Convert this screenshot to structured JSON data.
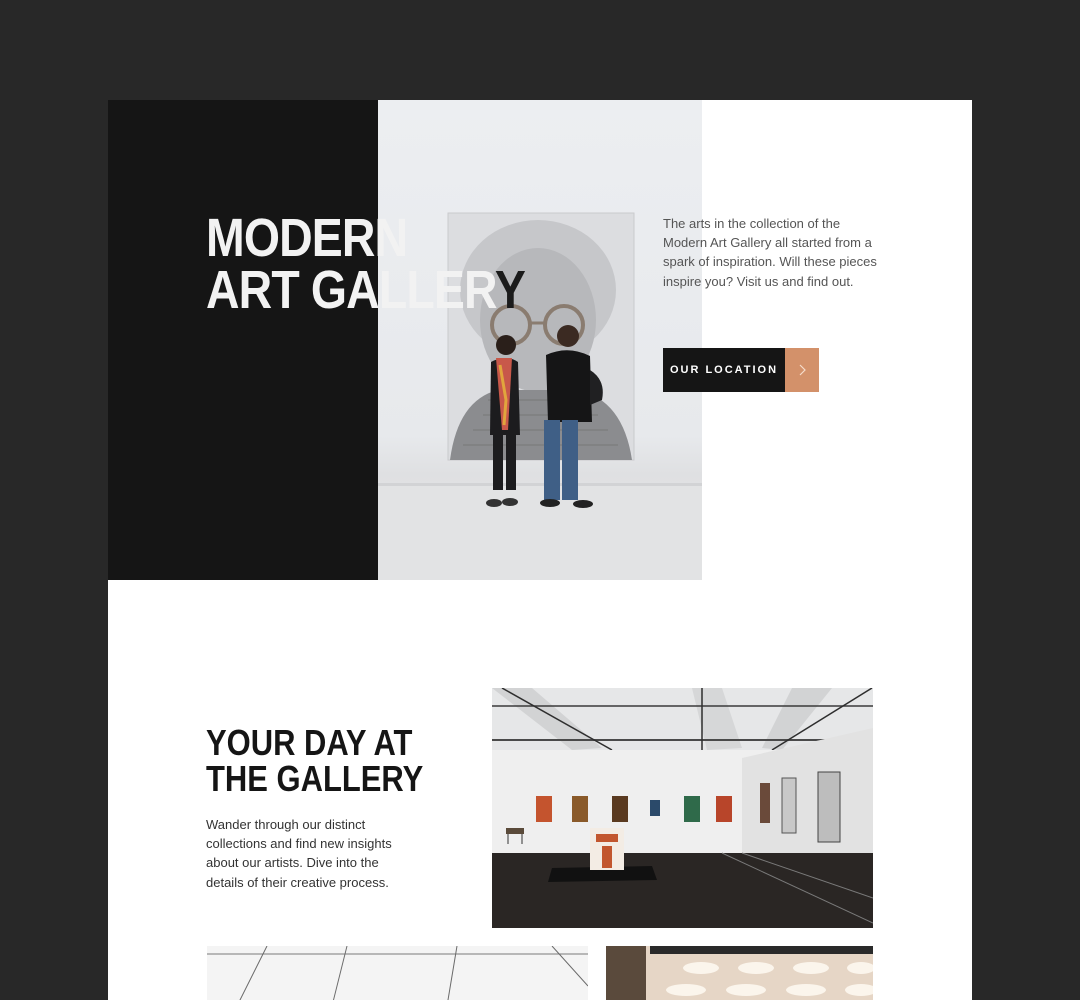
{
  "hero": {
    "title_line1": "MODERN",
    "title_line2": "ART GALLERY",
    "description": "The arts in the collection of the Modern Art Gallery all started from a spark of inspiration. Will these pieces inspire you? Visit us and find out.",
    "location_button": "OUR LOCATION",
    "button_icon": "chevron-right-icon",
    "photo": "visitors-viewing-portrait-photo"
  },
  "day": {
    "title_line1": "YOUR DAY AT",
    "title_line2": "THE GALLERY",
    "description": "Wander through our distinct collections and find new insights about our artists. Dive into the details of their creative process.",
    "photos": [
      "gallery-hall-photo",
      "gallery-ceiling-photo",
      "gallery-lights-photo"
    ]
  },
  "colors": {
    "page_background": "#282828",
    "dark": "#151515",
    "accent": "#d3916a",
    "white": "#ffffff"
  }
}
